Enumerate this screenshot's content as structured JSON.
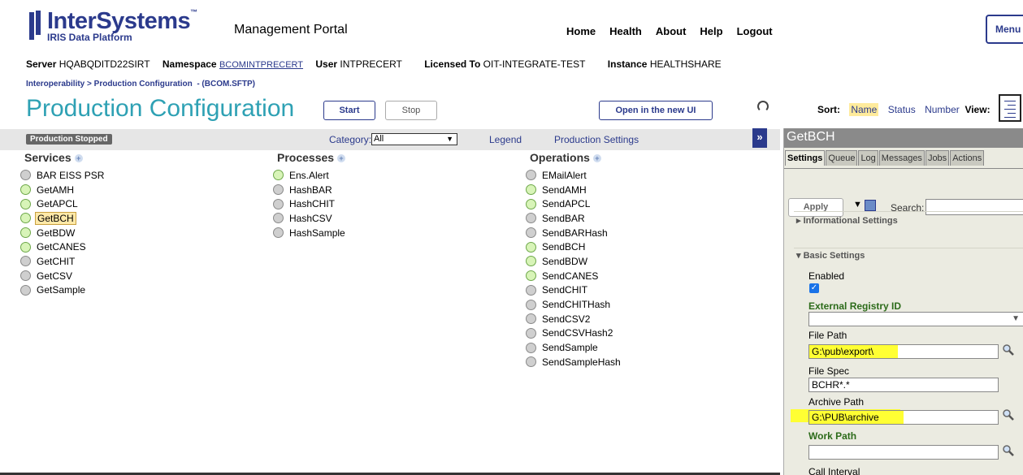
{
  "header": {
    "logo_main": "InterSystems",
    "logo_tm": "™",
    "logo_sub": "IRIS Data Platform",
    "portal_title": "Management Portal",
    "nav": [
      "Home",
      "Health",
      "About",
      "Help",
      "Logout"
    ],
    "menu_button": "Menu"
  },
  "info": {
    "server_label": "Server",
    "server": "HQABQDITD22SIRT",
    "namespace_label": "Namespace",
    "namespace": "BCOMINTPRECERT",
    "user_label": "User",
    "user": "INTPRECERT",
    "licensed_label": "Licensed To",
    "licensed": "OIT-INTEGRATE-TEST",
    "instance_label": "Instance",
    "instance": "HEALTHSHARE"
  },
  "breadcrumb": {
    "root": "Interoperability",
    "sep": ">",
    "page": "Production Configuration",
    "production": "- (BCOM.SFTP)"
  },
  "page_title": "Production Configuration",
  "buttons": {
    "start": "Start",
    "stop": "Stop",
    "new_ui": "Open in the new UI"
  },
  "sort": {
    "label": "Sort:",
    "options": [
      "Name",
      "Status",
      "Number"
    ],
    "selected": "Name",
    "view_label": "View:"
  },
  "toolbar": {
    "status_badge": "Production Stopped",
    "category_label": "Category:",
    "category_value": "All",
    "legend": "Legend",
    "production_settings": "Production Settings",
    "expand": "»"
  },
  "columns": {
    "services": {
      "title": "Services",
      "items": [
        {
          "name": "BAR EISS PSR",
          "status": "gray"
        },
        {
          "name": "GetAMH",
          "status": "green"
        },
        {
          "name": "GetAPCL",
          "status": "green"
        },
        {
          "name": "GetBCH",
          "status": "green",
          "selected": true
        },
        {
          "name": "GetBDW",
          "status": "green"
        },
        {
          "name": "GetCANES",
          "status": "green"
        },
        {
          "name": "GetCHIT",
          "status": "gray"
        },
        {
          "name": "GetCSV",
          "status": "gray"
        },
        {
          "name": "GetSample",
          "status": "gray"
        }
      ]
    },
    "processes": {
      "title": "Processes",
      "items": [
        {
          "name": "Ens.Alert",
          "status": "green"
        },
        {
          "name": "HashBAR",
          "status": "gray"
        },
        {
          "name": "HashCHIT",
          "status": "gray"
        },
        {
          "name": "HashCSV",
          "status": "gray"
        },
        {
          "name": "HashSample",
          "status": "gray"
        }
      ]
    },
    "operations": {
      "title": "Operations",
      "items": [
        {
          "name": "EMailAlert",
          "status": "gray"
        },
        {
          "name": "SendAMH",
          "status": "green"
        },
        {
          "name": "SendAPCL",
          "status": "green"
        },
        {
          "name": "SendBAR",
          "status": "gray"
        },
        {
          "name": "SendBARHash",
          "status": "gray"
        },
        {
          "name": "SendBCH",
          "status": "green"
        },
        {
          "name": "SendBDW",
          "status": "green"
        },
        {
          "name": "SendCANES",
          "status": "green"
        },
        {
          "name": "SendCHIT",
          "status": "gray"
        },
        {
          "name": "SendCHITHash",
          "status": "gray"
        },
        {
          "name": "SendCSV2",
          "status": "gray"
        },
        {
          "name": "SendCSVHash2",
          "status": "gray"
        },
        {
          "name": "SendSample",
          "status": "gray"
        },
        {
          "name": "SendSampleHash",
          "status": "gray"
        }
      ]
    }
  },
  "panel": {
    "title": "GetBCH",
    "tabs": [
      "Settings",
      "Queue",
      "Log",
      "Messages",
      "Jobs",
      "Actions"
    ],
    "active_tab": "Settings",
    "apply": "Apply",
    "search_label": "Search:",
    "informational_settings": "▸ Informational Settings",
    "basic_settings": "▾ Basic Settings",
    "enabled_label": "Enabled",
    "enabled": true,
    "external_registry_label": "External Registry ID",
    "external_registry_value": "",
    "file_path_label": "File Path",
    "file_path": "G:\\pub\\export\\",
    "file_spec_label": "File Spec",
    "file_spec": "BCHR*.*",
    "archive_path_label": "Archive Path",
    "archive_path": "G:\\PUB\\archive",
    "work_path_label": "Work Path",
    "work_path": "",
    "call_interval_label": "Call Interval"
  },
  "colors": {
    "brand": "#2b3a8c",
    "title_teal": "#2ea1b4",
    "status_green": "#d8f4b8",
    "status_gray": "#cfcfcf",
    "highlight": "#ffff33"
  }
}
